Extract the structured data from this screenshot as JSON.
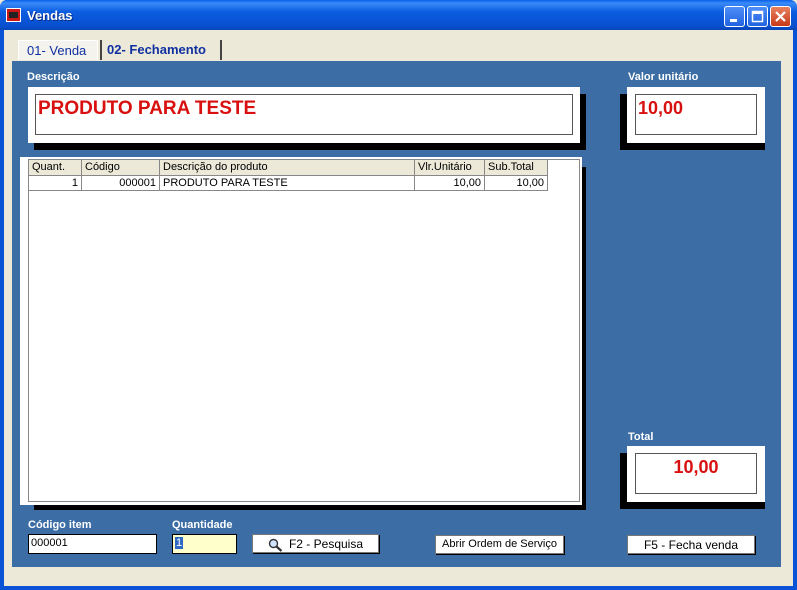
{
  "window": {
    "title": "Vendas"
  },
  "tabs": [
    {
      "label": "01- Venda"
    },
    {
      "label": "02- Fechamento"
    }
  ],
  "descricao": {
    "label": "Descrição",
    "value": "PRODUTO PARA TESTE"
  },
  "valor_unitario": {
    "label": "Valor unitário",
    "value": "10,00"
  },
  "total": {
    "label": "Total",
    "value": "10,00"
  },
  "grid": {
    "columns": [
      "Quant.",
      "Código",
      "Descrição do produto",
      "Vlr.Unitário",
      "Sub.Total"
    ],
    "rows": [
      {
        "quant": "1",
        "codigo": "000001",
        "descricao": "PRODUTO PARA TESTE",
        "vlr_unitario": "10,00",
        "sub_total": "10,00"
      }
    ]
  },
  "codigo_item": {
    "label": "Código item",
    "value": "000001"
  },
  "quantidade": {
    "label": "Quantidade",
    "value": "1"
  },
  "buttons": {
    "pesquisa": "F2 - Pesquisa",
    "ordem_servico": "Abrir Ordem de Serviço",
    "fecha_venda": "F5 - Fecha venda"
  },
  "colors": {
    "value_red": "#d81010",
    "panel_blue": "#3c6ea5",
    "titlebar_blue": "#0a52d6"
  }
}
